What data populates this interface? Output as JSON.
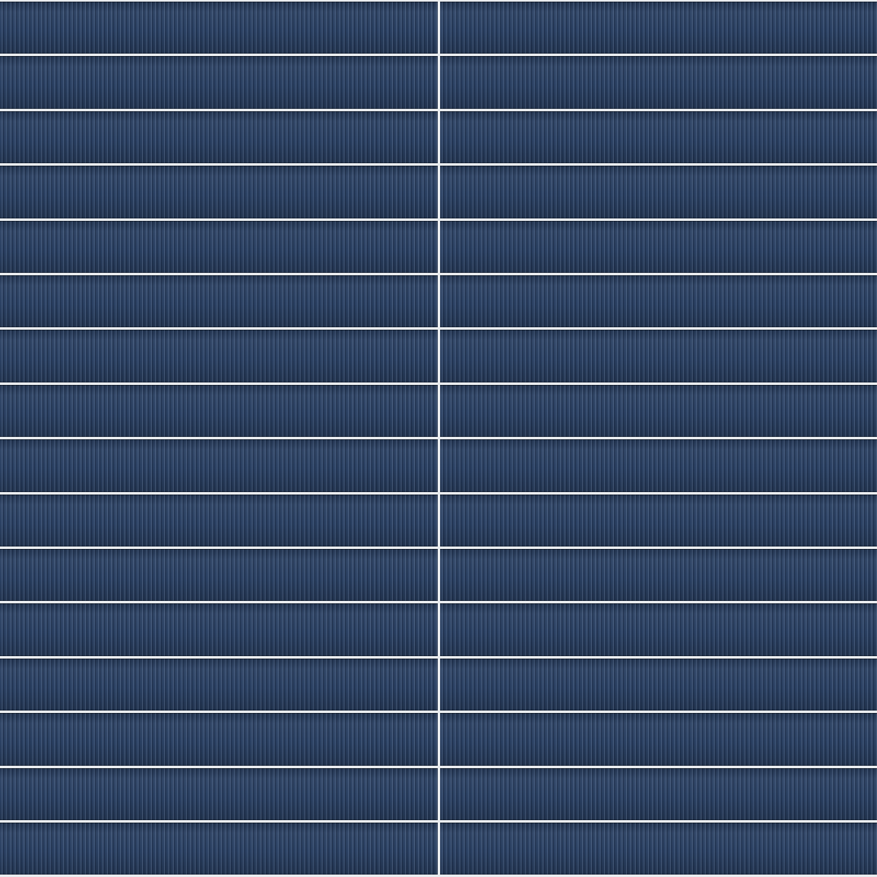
{
  "scene": {
    "subject": "fluted-ceramic-tile-wall",
    "tile_color": "#2b4163",
    "grout_color": "#e9ecef",
    "grid": {
      "columns": 2,
      "rows": 16
    }
  }
}
